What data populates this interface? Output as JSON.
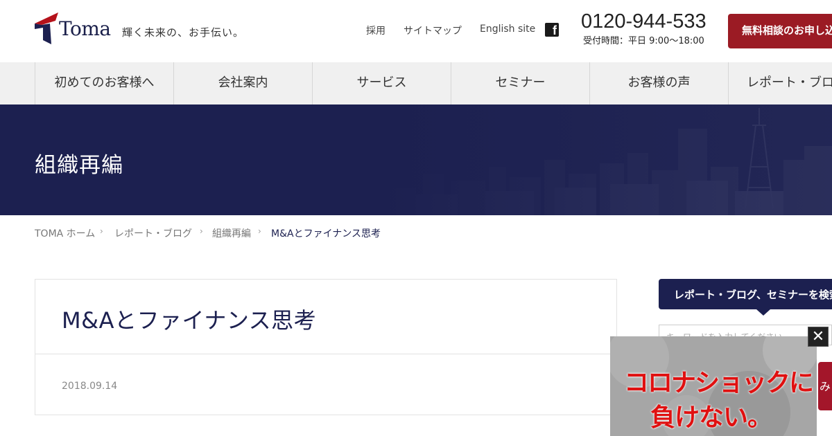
{
  "header": {
    "logo_text": "Toma",
    "tagline": "輝く未来の、お手伝い。",
    "links": [
      "採用",
      "サイトマップ",
      "English site"
    ],
    "facebook_icon": "facebook-icon",
    "phone": "0120-944-533",
    "hours": "受付時間：平日 9:00〜18:00",
    "cta_label": "無料相談のお申し込み",
    "colors": {
      "brand_navy": "#1c2050",
      "brand_red": "#9b1b24"
    }
  },
  "nav": {
    "items": [
      "初めてのお客様へ",
      "会社案内",
      "サービス",
      "セミナー",
      "お客様の声",
      "レポート・ブログ"
    ]
  },
  "hero": {
    "title": "組織再編"
  },
  "breadcrumb": {
    "items": [
      "TOMA ホーム",
      "レポート・ブログ",
      "組織再編"
    ],
    "current": "M&Aとファイナンス思考"
  },
  "article": {
    "title": "M&Aとファイナンス思考",
    "date": "2018.09.14"
  },
  "sidebar": {
    "heading": "レポート・ブログ、セミナーを検索",
    "search_placeholder": "キーワードを入力してください"
  },
  "popup": {
    "line1": "コロナショックに",
    "line2": "負けない。",
    "close_icon": "close-icon",
    "side_tab_label": "み"
  }
}
